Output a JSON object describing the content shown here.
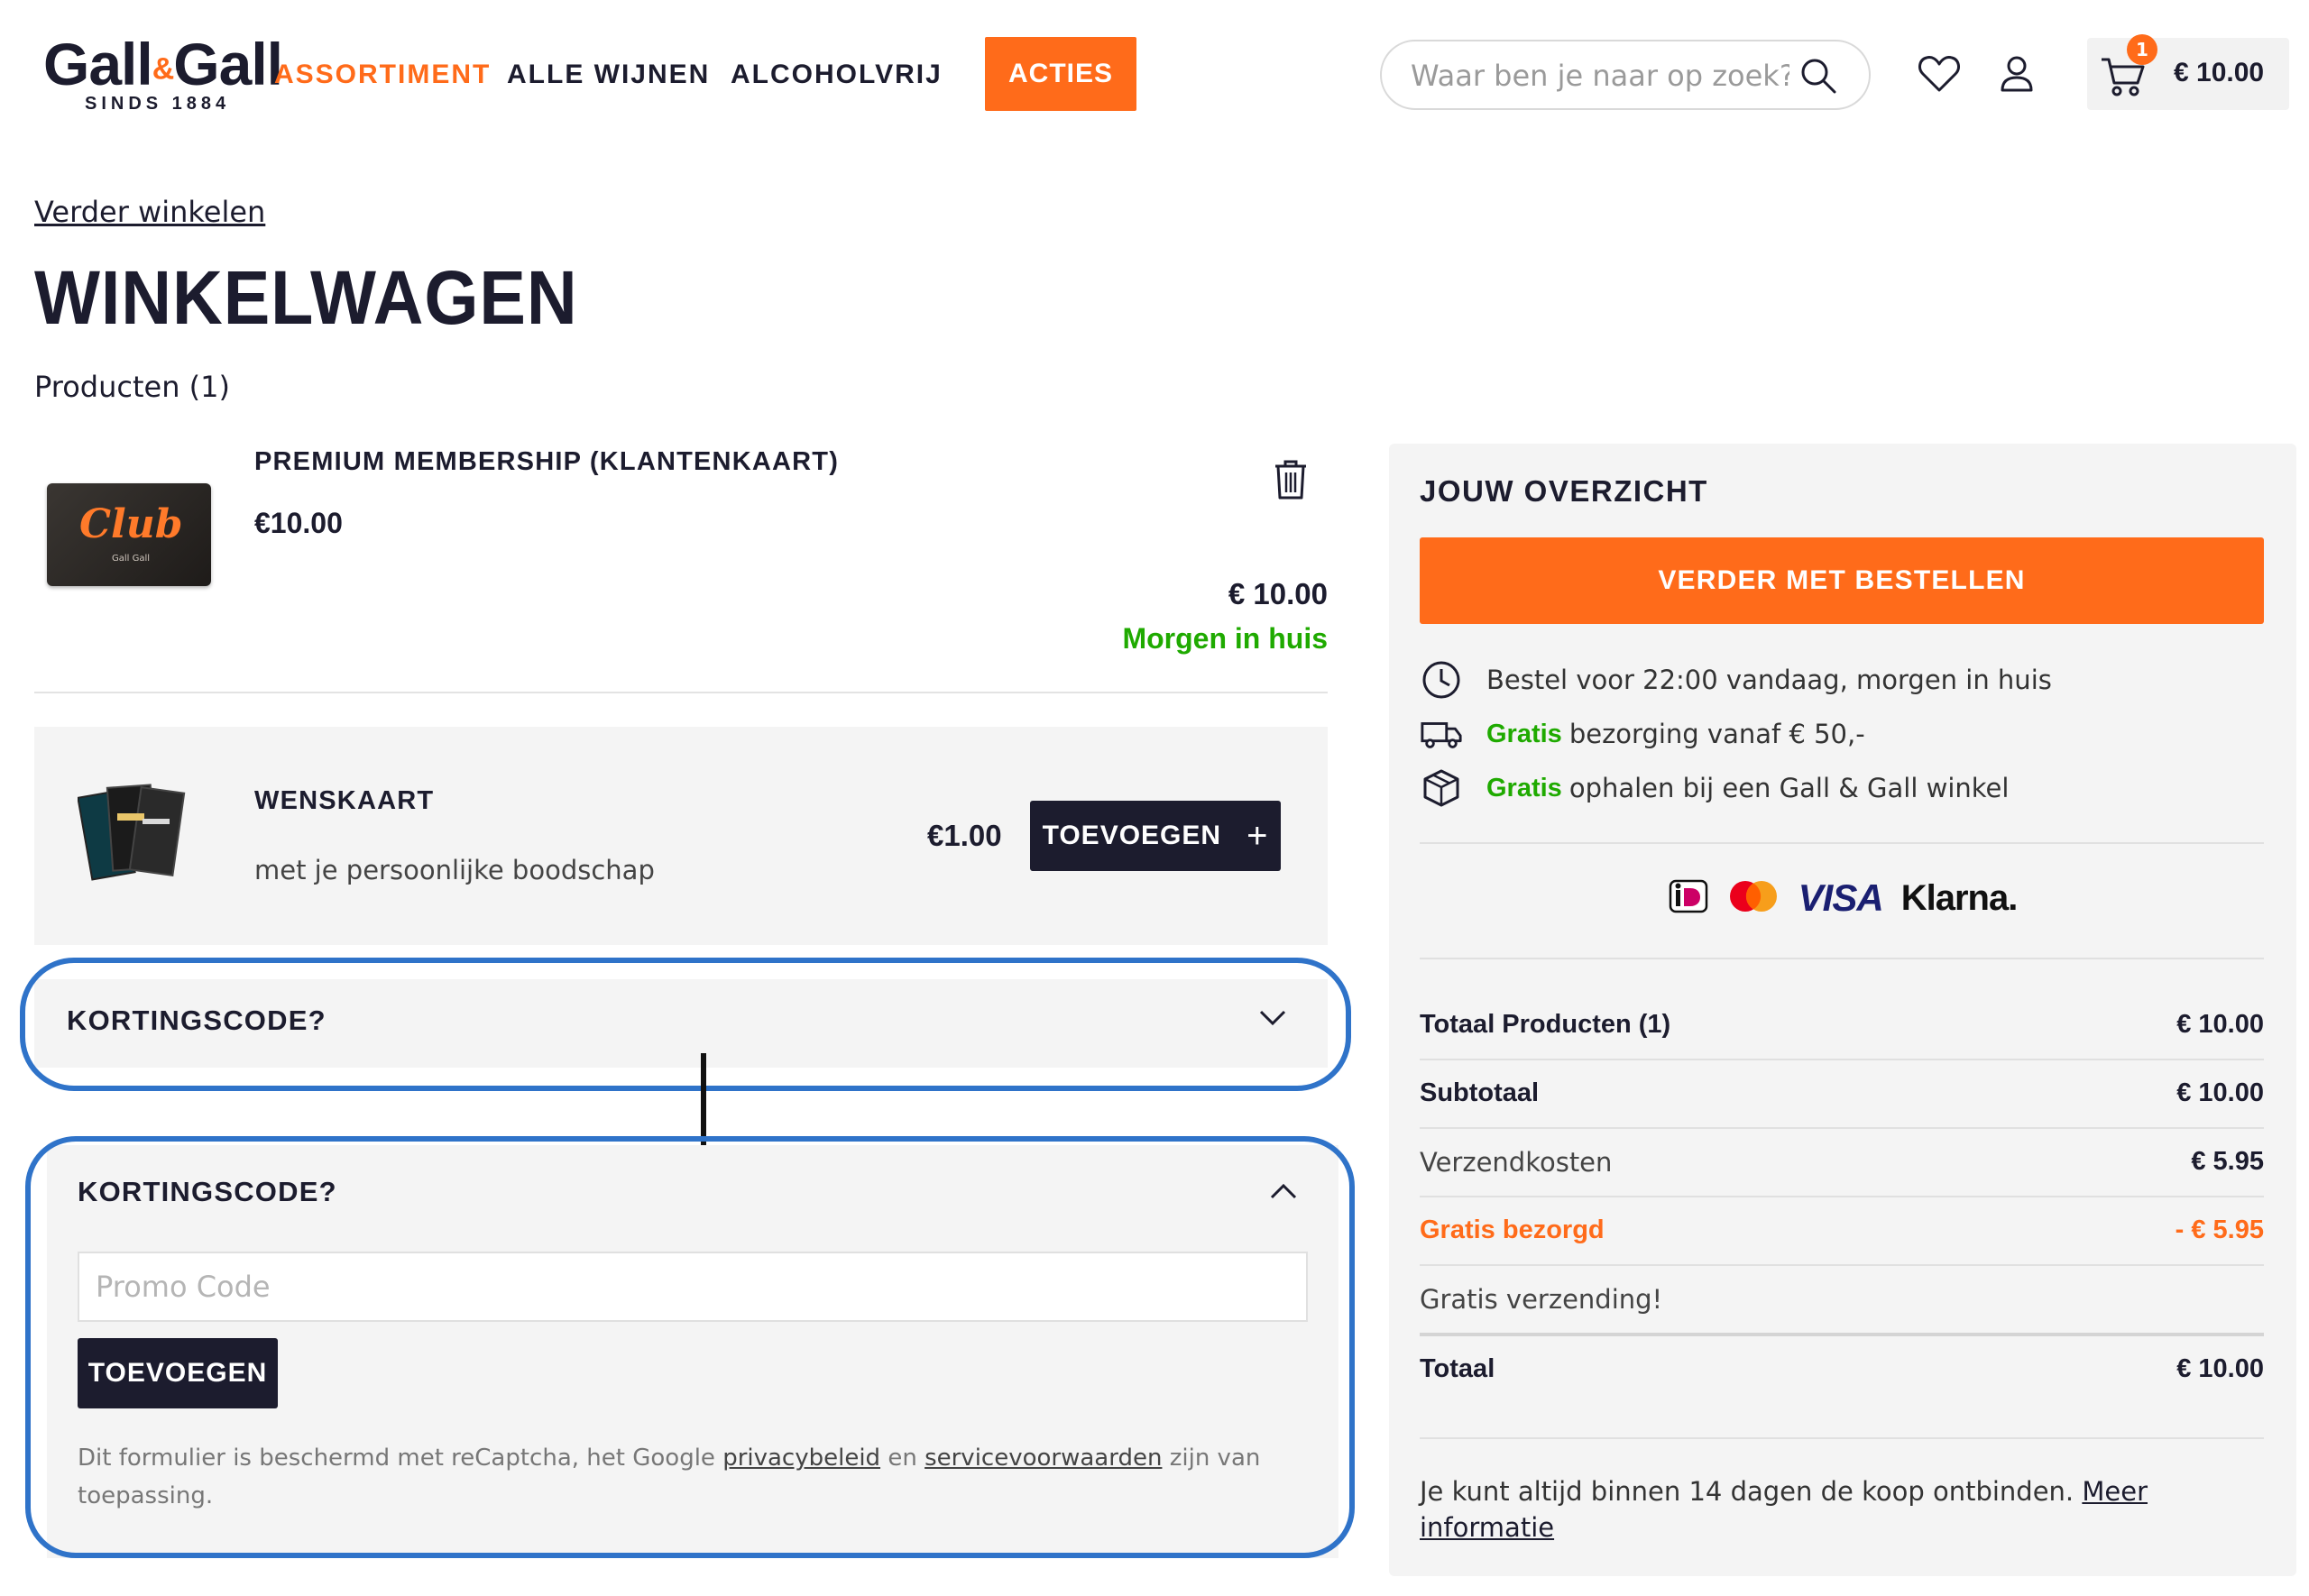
{
  "header": {
    "logo_text": "Gall",
    "logo_amp": "&",
    "logo_text2": "Gall",
    "logo_sub": "SINDS 1884",
    "nav": [
      "ASSORTIMENT",
      "ALLE WIJNEN",
      "ALCOHOLVRIJ"
    ],
    "acties": "ACTIES",
    "search_placeholder": "Waar ben je naar op zoek?",
    "cart_count": "1",
    "cart_amount": "€ 10.00"
  },
  "page": {
    "back_link": "Verder winkelen",
    "title": "WINKELWAGEN",
    "products_count": "Producten (1)"
  },
  "product": {
    "card_word": "Club",
    "card_sub": "Gall Gall",
    "title": "PREMIUM MEMBERSHIP (KLANTENKAART)",
    "price": "€10.00",
    "line_total": "€ 10.00",
    "delivery": "Morgen in huis"
  },
  "upsell": {
    "title": "WENSKAART",
    "subtitle": "met je persoonlijke boodschap",
    "price": "€1.00",
    "button": "TOEVOEGEN",
    "button_icon": "+"
  },
  "promo": {
    "label": "KORTINGSCODE?",
    "placeholder": "Promo Code",
    "button": "TOEVOEGEN",
    "recaptcha_pre": "Dit formulier is beschermd met reCaptcha, het Google ",
    "privacy_link": "privacybeleid",
    "recaptcha_mid": " en ",
    "terms_link": "servicevoorwaarden",
    "recaptcha_post": " zijn van toepassing."
  },
  "summary": {
    "title": "JOUW OVERZICHT",
    "checkout_button": "VERDER MET BESTELLEN",
    "usp": [
      {
        "icon": "clock-icon",
        "bold": "",
        "text": "Bestel voor 22:00 vandaag, morgen in huis"
      },
      {
        "icon": "truck-icon",
        "bold": "Gratis",
        "text": "bezorging vanaf € 50,-"
      },
      {
        "icon": "box-icon",
        "bold": "Gratis",
        "text": "ophalen bij een Gall & Gall winkel"
      }
    ],
    "payments": {
      "visa": "VISA",
      "klarna": "Klarna."
    },
    "rows": [
      {
        "label": "Totaal Producten (1)",
        "value": "€ 10.00"
      },
      {
        "label": "Subtotaal",
        "value": "€ 10.00"
      },
      {
        "label": "Verzendkosten",
        "value": "€ 5.95"
      },
      {
        "label": "Gratis bezorgd",
        "value": "- € 5.95"
      },
      {
        "label": "Gratis verzending!",
        "value": ""
      },
      {
        "label": "Totaal",
        "value": "€ 10.00"
      }
    ],
    "legal_text": "Je kunt altijd binnen 14 dagen de koop ontbinden. ",
    "legal_link": "Meer informatie"
  },
  "colors": {
    "accent": "#ff6b1a",
    "dark": "#1c1c2e",
    "green": "#1faa00",
    "highlight": "#2f73c9"
  }
}
